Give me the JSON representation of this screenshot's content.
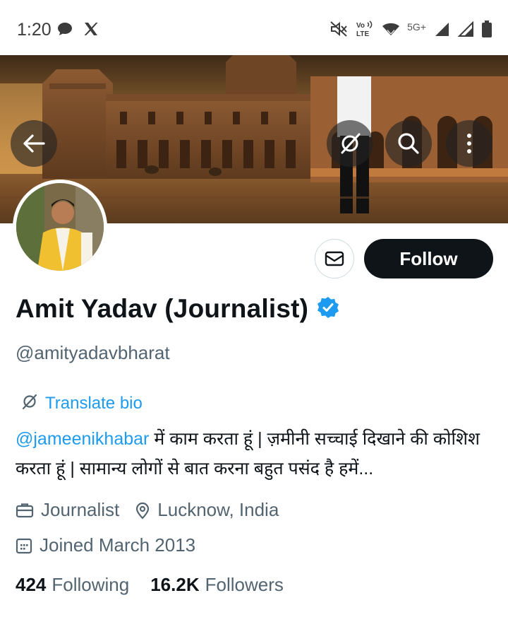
{
  "status_bar": {
    "time": "1:20",
    "network_label": "5G+",
    "volte_label": "Vo LTE",
    "icons": [
      "chat-bubble-icon",
      "x-logo-icon",
      "mute-icon",
      "volte-icon",
      "wifi-icon",
      "signal-icon",
      "signal-icon",
      "battery-icon"
    ]
  },
  "header": {
    "icons": [
      "back-arrow-icon",
      "translate-icon",
      "search-icon",
      "more-vertical-icon"
    ]
  },
  "profile": {
    "display_name": "Amit Yadav (Journalist)",
    "verified": true,
    "handle": "@amityadavbharat",
    "follow_label": "Follow",
    "translate_label": "Translate bio",
    "bio_mention": "@jameenikhabar",
    "bio_text": " में काम करता हूं | ज़मीनी सच्चाई दिखाने की कोशिश करता हूं | सामान्य लोगों से बात करना बहुत पसंद है हमें...",
    "profession": "Journalist",
    "location": "Lucknow, India",
    "joined": "Joined March 2013",
    "following_count": "424",
    "following_label": "Following",
    "followers_count": "16.2K",
    "followers_label": "Followers"
  },
  "colors": {
    "accent": "#1d9bf0",
    "text_primary": "#0f1419",
    "text_secondary": "#536471",
    "follow_bg": "#0f1419"
  }
}
